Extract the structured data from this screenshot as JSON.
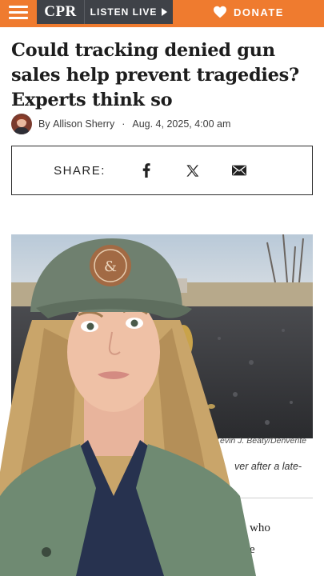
{
  "nav": {
    "logo": "CPR",
    "listen_label": "LISTEN LIVE",
    "donate_label": "DONATE",
    "brand_color": "#ef7b2f",
    "nav_color": "#3f4248"
  },
  "article": {
    "headline": "Could tracking denied gun sales help prevent tragedies? Experts think so",
    "byline_prefix": "By",
    "author": "Allison Sherry",
    "separator": "·",
    "date": "Aug. 4, 2025, 4:00 am"
  },
  "share": {
    "label": "SHARE:",
    "icons": [
      "facebook-icon",
      "x-icon",
      "email-icon"
    ]
  },
  "photo": {
    "credit": "Kevin J. Beaty/Denverite",
    "caption_partial": "ver after a late-"
  },
  "body_partial": {
    "line1": "who",
    "line2": "e"
  }
}
